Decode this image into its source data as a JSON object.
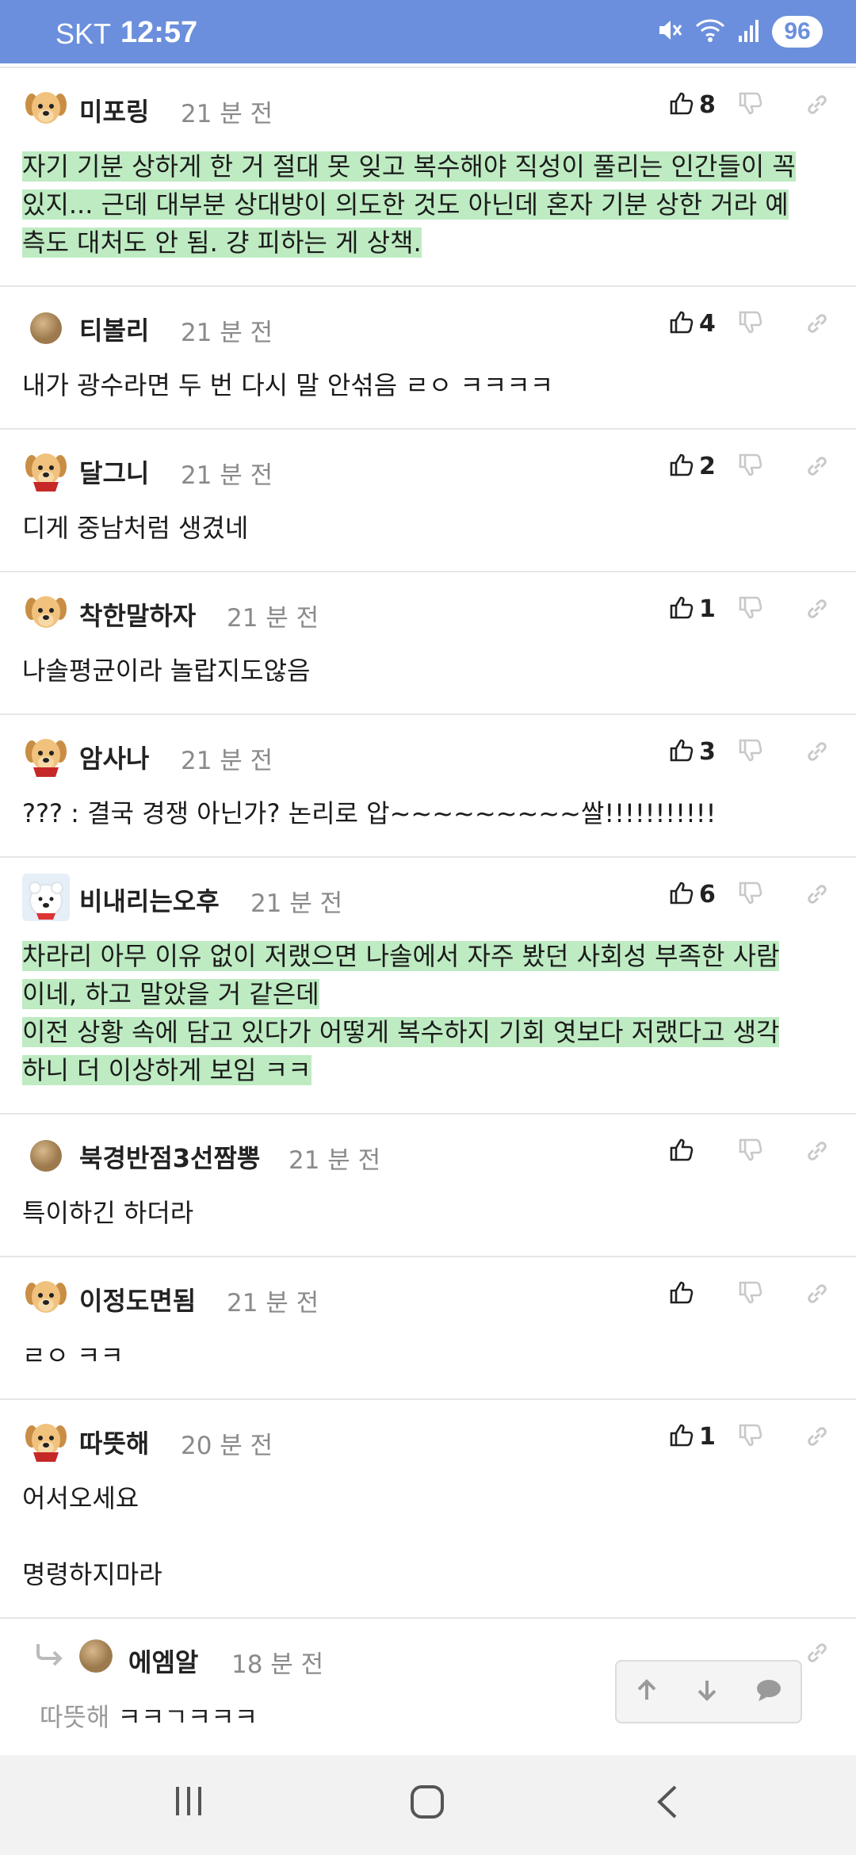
{
  "status_bar": {
    "carrier": "SKT",
    "time": "12:57",
    "battery": "96"
  },
  "comments": [
    {
      "avatar": "puppy-avatar",
      "name": "미포링",
      "time": "21 분 전",
      "likes": "8",
      "lines": [
        "자기 기분 상하게 한 거 절대 못 잊고 복수해야 직성이 풀리는 인간들이 꼭",
        "있지... 근데 대부분 상대방이 의도한 것도 아닌데 혼자 기분 상한 거라 예",
        "측도 대처도 안 됨. 걍 피하는 게 상책."
      ]
    },
    {
      "avatar": "brown-circle-avatar",
      "name": "티볼리",
      "time": "21 분 전",
      "likes": "4",
      "lines": [
        "내가 광수라면 두 번 다시 말 안섞음 ㄹㅇ ㅋㅋㅋㅋ"
      ]
    },
    {
      "avatar": "puppy-red-avatar",
      "name": "달그니",
      "time": "21 분 전",
      "likes": "2",
      "lines": [
        "디게 중남처럼 생겼네"
      ]
    },
    {
      "avatar": "puppy-avatar",
      "name": "착한말하자",
      "time": "21 분 전",
      "likes": "1",
      "lines": [
        "나솔평균이라 놀랍지도않음"
      ]
    },
    {
      "avatar": "puppy-red-avatar",
      "name": "암사나",
      "time": "21 분 전",
      "likes": "3",
      "lines": [
        "??? : 결국 경쟁 아닌가? 논리로 압~~~~~~~~~쌀!!!!!!!!!!!"
      ]
    },
    {
      "avatar": "polar-bear-avatar",
      "name": "비내리는오후",
      "time": "21 분 전",
      "likes": "6",
      "lines": [
        "차라리 아무 이유 없이 저랬으면 나솔에서 자주 봤던 사회성 부족한 사람",
        "이네, 하고 말았을 거 같은데",
        "이전 상황 속에 담고 있다가 어떻게 복수하지 기회 엿보다 저랬다고 생각",
        "하니 더 이상하게 보임 ㅋㅋ"
      ]
    },
    {
      "avatar": "brown-circle-avatar",
      "name": "북경반점3선짬뽕",
      "time": "21 분 전",
      "likes": "",
      "lines": [
        "특이하긴 하더라"
      ]
    },
    {
      "avatar": "puppy-avatar",
      "name": "이정도면됨",
      "time": "21 분 전",
      "likes": "",
      "lines": [
        "ㄹㅇ ㅋㅋ"
      ]
    },
    {
      "avatar": "puppy-red-avatar",
      "name": "따뜻해",
      "time": "20 분 전",
      "likes": "1",
      "lines": [
        "어서오세요",
        "",
        "명령하지마라"
      ]
    }
  ],
  "reply": {
    "name": "에엠알",
    "time": "18 분 전",
    "mention": "따뜻해",
    "text": "ㅋㅋㄱㅋㅋㅋ"
  }
}
